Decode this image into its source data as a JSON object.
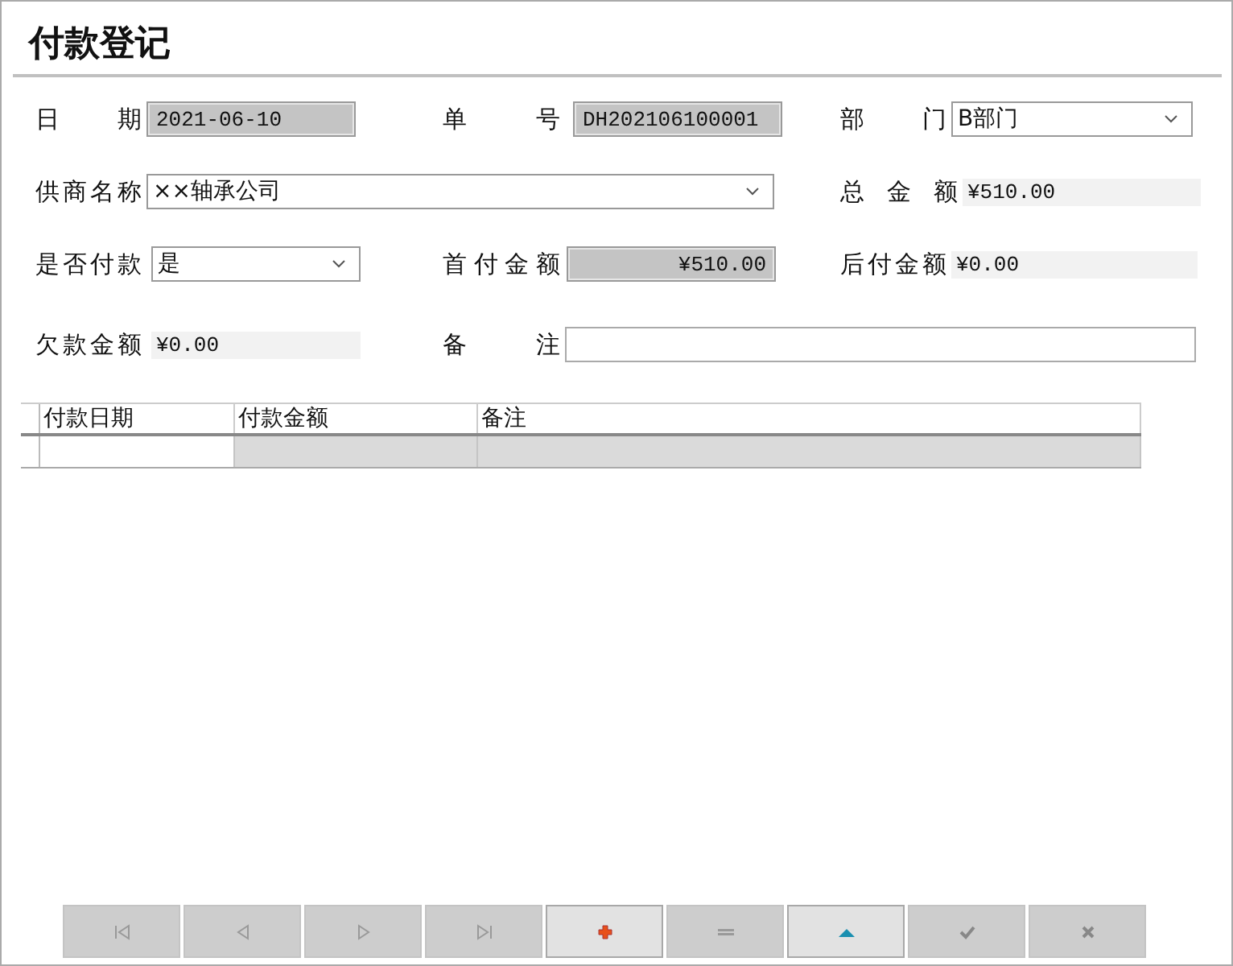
{
  "window": {
    "title": "付款登记"
  },
  "form_rows": [
    {
      "fields": [
        {
          "label": "日 期",
          "kind": "readonly",
          "value": "2021-06-10"
        },
        {
          "label": "单 号",
          "kind": "readonly",
          "value": "DH202106100001"
        },
        {
          "label": "部 门",
          "kind": "select",
          "value": "B部门"
        }
      ]
    },
    {
      "fields": [
        {
          "label": "供商名称",
          "kind": "select",
          "value": "××轴承公司"
        },
        {
          "label": "总 金 额",
          "kind": "display",
          "value": "¥510.00"
        }
      ]
    },
    {
      "fields": [
        {
          "label": "是否付款",
          "kind": "select",
          "value": "是"
        },
        {
          "label": "首付金额",
          "kind": "readonly_right",
          "value": "¥510.00"
        },
        {
          "label": "后付金额",
          "kind": "display",
          "value": "¥0.00"
        }
      ]
    },
    {
      "fields": [
        {
          "label": "欠款金额",
          "kind": "display",
          "value": "¥0.00"
        },
        {
          "label": "备 注",
          "kind": "input"
        }
      ]
    }
  ],
  "grid": {
    "columns": [
      "付款日期",
      "付款金额",
      "备注"
    ]
  },
  "navigator": [
    {
      "kind": "first",
      "enabled": false
    },
    {
      "kind": "prior",
      "enabled": false
    },
    {
      "kind": "next",
      "enabled": false
    },
    {
      "kind": "last",
      "enabled": false
    },
    {
      "kind": "insert",
      "enabled": true
    },
    {
      "kind": "delete",
      "enabled": false
    },
    {
      "kind": "edit",
      "enabled": true
    },
    {
      "kind": "post",
      "enabled": false
    },
    {
      "kind": "cancel",
      "enabled": false
    }
  ]
}
